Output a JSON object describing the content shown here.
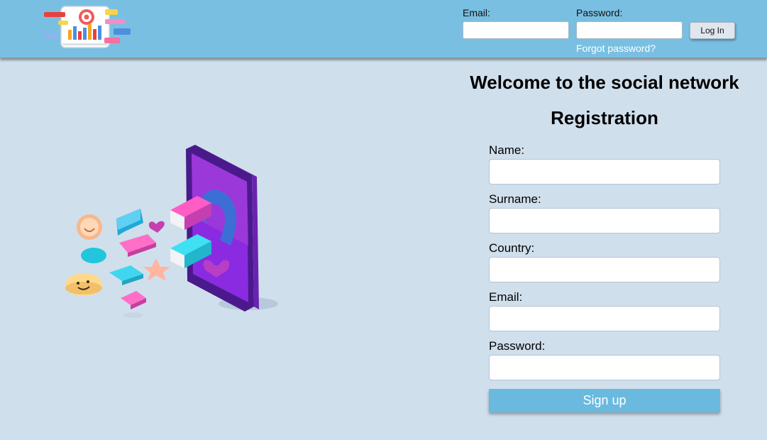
{
  "header": {
    "login": {
      "email_label": "Email:",
      "email_value": "",
      "password_label": "Password:",
      "password_value": "",
      "login_button": "Log In",
      "forgot_link": "Forgot password?"
    }
  },
  "main": {
    "welcome_title": "Welcome to the social network",
    "registration_title": "Registration",
    "form": {
      "name_label": "Name:",
      "surname_label": "Surname:",
      "country_label": "Country:",
      "email_label": "Email:",
      "password_label": "Password:",
      "signup_button": "Sign up"
    }
  },
  "colors": {
    "header_bg": "#79bfe2",
    "page_bg": "#d0dfec",
    "signup_bg": "#6ab9df"
  },
  "icons": [
    "app-logo-icon",
    "social-magnet-illustration"
  ]
}
